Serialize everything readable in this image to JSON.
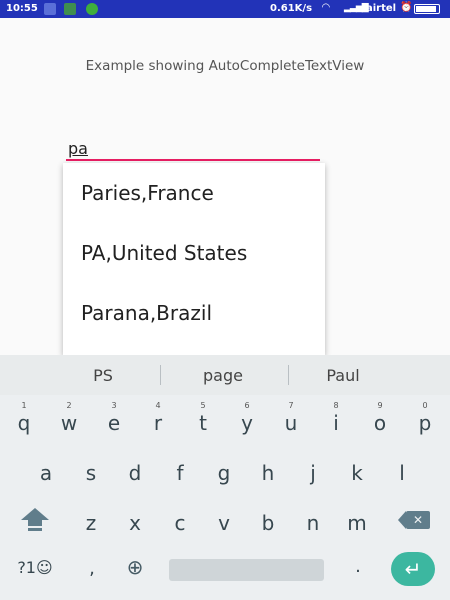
{
  "status_bar": {
    "time": "10:55",
    "network_rate": "0.61K/s",
    "carrier": "airtel",
    "bg_color": "#2233b8"
  },
  "app": {
    "title": "Example showing AutoCompleteTextView",
    "input_value": "pa",
    "underline_color": "#e91e63",
    "suggestions": [
      "Paries,France",
      "PA,United States",
      "Parana,Brazil"
    ]
  },
  "keyboard": {
    "word_suggestions": [
      "PS",
      "page",
      "Paul"
    ],
    "row1": [
      {
        "char": "q",
        "hint": "1"
      },
      {
        "char": "w",
        "hint": "2"
      },
      {
        "char": "e",
        "hint": "3"
      },
      {
        "char": "r",
        "hint": "4"
      },
      {
        "char": "t",
        "hint": "5"
      },
      {
        "char": "y",
        "hint": "6"
      },
      {
        "char": "u",
        "hint": "7"
      },
      {
        "char": "i",
        "hint": "8"
      },
      {
        "char": "o",
        "hint": "9"
      },
      {
        "char": "p",
        "hint": "0"
      }
    ],
    "row2": [
      "a",
      "s",
      "d",
      "f",
      "g",
      "h",
      "j",
      "k",
      "l"
    ],
    "row3": [
      "z",
      "x",
      "c",
      "v",
      "b",
      "n",
      "m"
    ],
    "symbols_label": "?1☺",
    "comma_label": ",",
    "period_label": ".",
    "enter_color": "#3cb7a0",
    "icons": [
      "shift-icon",
      "backspace-icon",
      "globe-icon",
      "enter-icon"
    ]
  }
}
